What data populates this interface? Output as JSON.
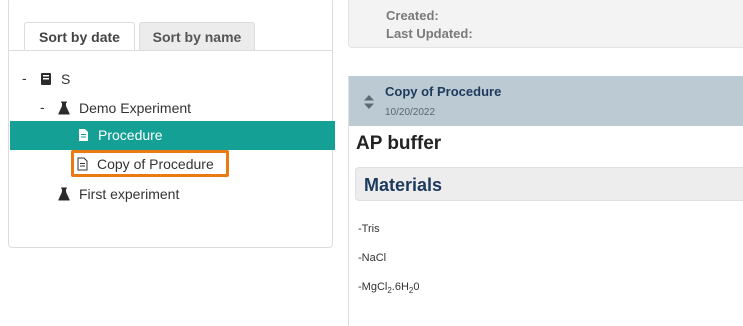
{
  "tabs": [
    {
      "label": "Sort by date",
      "active": true
    },
    {
      "label": "Sort by name",
      "active": false
    }
  ],
  "tree": {
    "root": {
      "label": "S",
      "icon": "notebook-icon"
    },
    "experiment": {
      "label": "Demo Experiment",
      "icon": "flask-icon"
    },
    "items": [
      {
        "label": "Procedure",
        "icon": "document-icon",
        "selected": true
      },
      {
        "label": "Copy of Procedure",
        "icon": "document-icon",
        "highlighted": true
      }
    ],
    "second_experiment": {
      "label": "First experiment",
      "icon": "flask-icon"
    },
    "collapse_symbol": "-"
  },
  "meta": {
    "created_label": "Created:",
    "updated_label": "Last Updated:"
  },
  "procedure": {
    "title": "Copy of Procedure",
    "date": "10/20/2022",
    "doc_title": "AP buffer",
    "section_title": "Materials",
    "materials": {
      "item1": "-Tris",
      "item2": "-NaCl",
      "item3_prefix": "-MgCl",
      "item3_sub1": "2",
      "item3_mid": ".6H",
      "item3_sub2": "2",
      "item3_suffix": "0"
    }
  },
  "colors": {
    "selected_row": "#15a096",
    "highlight_border": "#ec7a12",
    "header_bg": "#bccbd3",
    "title_text": "#1d3a5c"
  }
}
